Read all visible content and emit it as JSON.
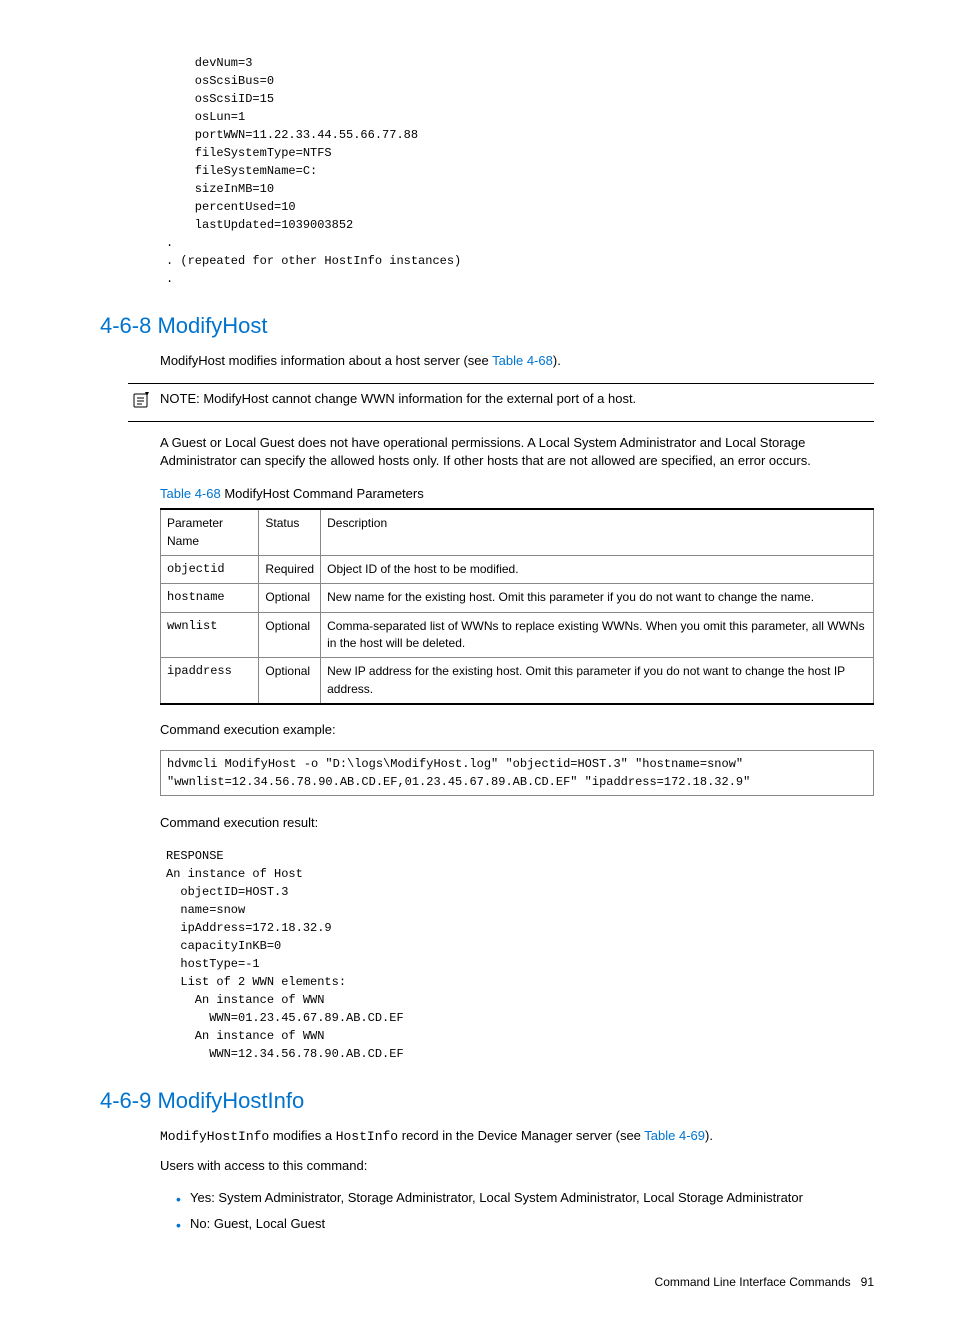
{
  "topCode": "    devNum=3\n    osScsiBus=0\n    osScsiID=15\n    osLun=1\n    portWWN=11.22.33.44.55.66.77.88\n    fileSystemType=NTFS\n    fileSystemName=C:\n    sizeInMB=10\n    percentUsed=10\n    lastUpdated=1039003852\n.\n. (repeated for other HostInfo instances)\n.",
  "section468": {
    "heading": "4-6-8 ModifyHost",
    "intro_before": "ModifyHost modifies information about a host server (see ",
    "intro_link": "Table 4-68",
    "intro_after": ").",
    "note_label": "NOTE:",
    "note_text": "  ModifyHost cannot change WWN information for the external port of a host.",
    "guest_text": "A Guest or Local Guest does not have operational permissions. A Local System Administrator and Local Storage Administrator can specify the allowed hosts only. If other hosts that are not allowed are specified, an error occurs.",
    "table_caption_link": "Table 4-68",
    "table_caption_rest": "  ModifyHost Command Parameters",
    "table_headers": [
      "Parameter Name",
      "Status",
      "Description"
    ],
    "table_rows": [
      {
        "name": "objectid",
        "status": "Required",
        "desc": "Object ID of the host to be modified."
      },
      {
        "name": "hostname",
        "status": "Optional",
        "desc": "New name for the existing host. Omit this parameter if you do not want to change the name."
      },
      {
        "name": "wwnlist",
        "status": "Optional",
        "desc": "Comma-separated list of WWNs to replace existing WWNs. When you omit this parameter, all WWNs in the host will be deleted."
      },
      {
        "name": "ipaddress",
        "status": "Optional",
        "desc": "New IP address for the existing host. Omit this parameter if you do not want to change the host IP address."
      }
    ],
    "exec_example_label": "Command execution example:",
    "exec_example_code": "hdvmcli ModifyHost -o \"D:\\logs\\ModifyHost.log\" \"objectid=HOST.3\" \"hostname=snow\"\n\"wwnlist=12.34.56.78.90.AB.CD.EF,01.23.45.67.89.AB.CD.EF\" \"ipaddress=172.18.32.9\"",
    "exec_result_label": "Command execution result:",
    "exec_result_code": "RESPONSE\nAn instance of Host\n  objectID=HOST.3\n  name=snow\n  ipAddress=172.18.32.9\n  capacityInKB=0\n  hostType=-1\n  List of 2 WWN elements:\n    An instance of WWN\n      WWN=01.23.45.67.89.AB.CD.EF\n    An instance of WWN\n      WWN=12.34.56.78.90.AB.CD.EF"
  },
  "section469": {
    "heading": "4-6-9 ModifyHostInfo",
    "intro_1": "ModifyHostInfo",
    "intro_2": " modifies a ",
    "intro_3": "HostInfo",
    "intro_4": " record in the Device Manager server (see ",
    "intro_link": "Table 4-69",
    "intro_5": ").",
    "users_label": "Users with access to this command:",
    "bullets": [
      "Yes: System Administrator, Storage Administrator, Local System Administrator, Local Storage Administrator",
      "No: Guest, Local Guest"
    ]
  },
  "footer": {
    "text": "Command Line Interface Commands",
    "page": "91"
  }
}
